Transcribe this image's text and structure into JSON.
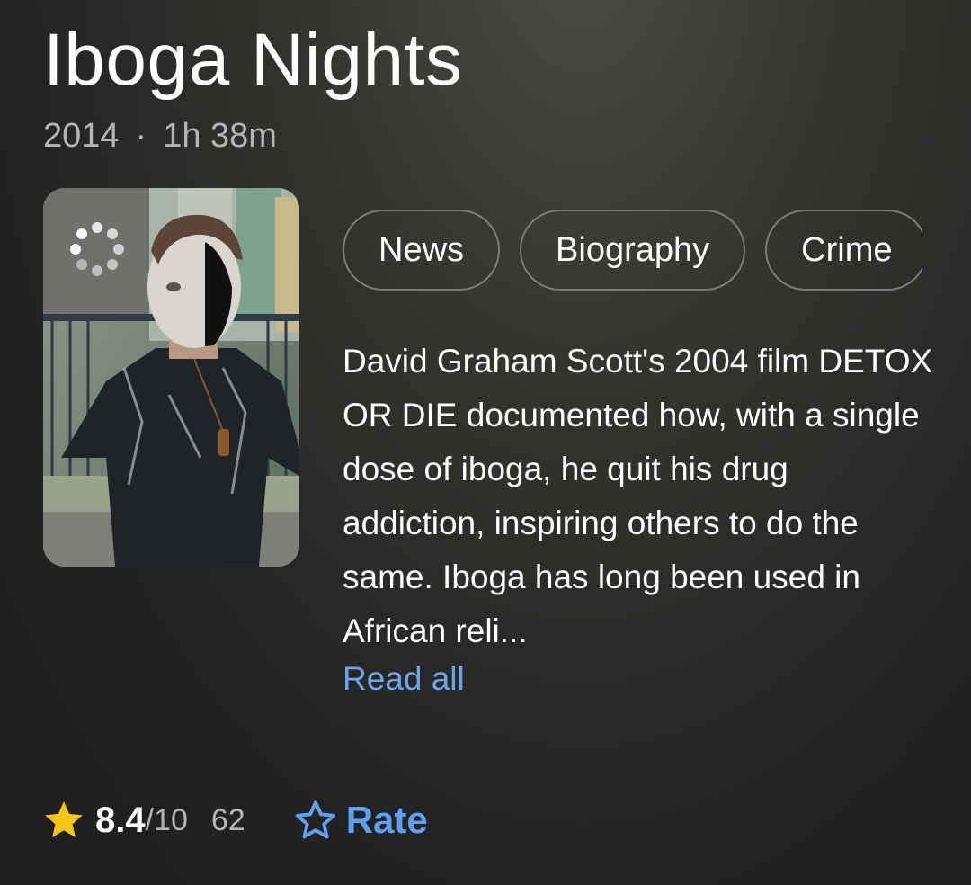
{
  "title": {
    "text": "Iboga Nights"
  },
  "meta": {
    "year": "2014",
    "separator": "·",
    "runtime": "1h 38m"
  },
  "genres": [
    "News",
    "Biography",
    "Crime"
  ],
  "description": "David Graham Scott's 2004 film DETOX OR DIE documented how, with a single dose of iboga, he quit his drug addiction, inspiring others to do the same. Iboga has long been used in African reli...",
  "read_all_label": "Read all",
  "rating": {
    "value": "8.4",
    "max": "/10",
    "count": "62"
  },
  "rate_label": "Rate",
  "colors": {
    "accent": "#5e9ff0",
    "star": "#f5c518",
    "link": "#6ea4e8"
  },
  "icons": {
    "rating": "star-icon",
    "rate": "star-outline-icon",
    "loading": "loading-spinner-icon"
  }
}
